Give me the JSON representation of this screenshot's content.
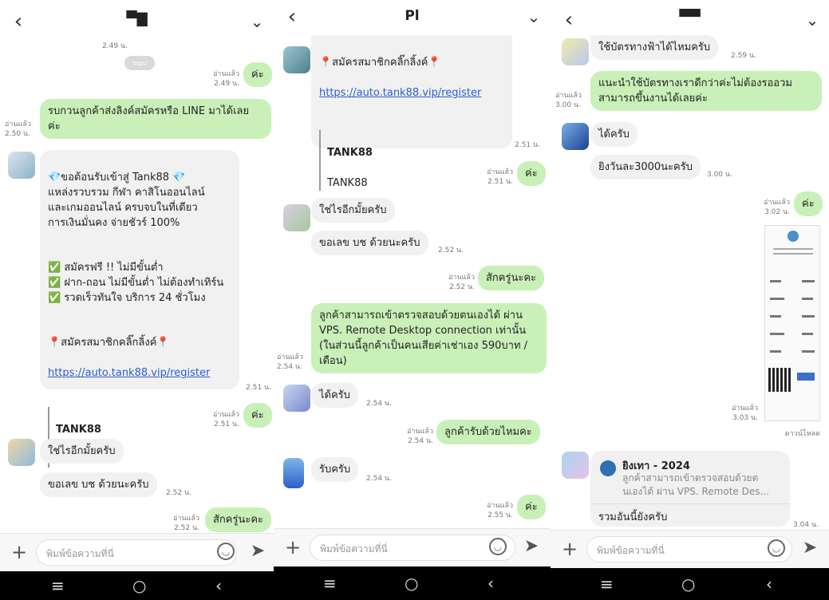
{
  "panels": [
    {
      "title": "▀▇",
      "input_placeholder": "พิมพ์ข้อความที่นี่",
      "top_time": "2.49 น.",
      "pill_text": "ขนบ",
      "messages": [
        {
          "dir": "out",
          "text": "ค่ะ",
          "read": "อ่านแล้ว",
          "time": "2.49 น."
        },
        {
          "dir": "out",
          "text": "รบกวนลูกค้าส่งลิงค์สมัครหรือ LINE มาได้เลย\nค่ะ",
          "read": "อ่านแล้ว",
          "time": "2.50 น."
        },
        {
          "dir": "in",
          "welcome": "💎ขอต้อนรับเข้าสู่ Tank88 💎\nแหล่งรวบรวม กีฬา คาสิโนออนไลน์\nและเกมออนไลน์ ครบจบในที่เดียว\nการเงินมั่นคง จ่ายชัวร์ 100%",
          "features": "✅ สมัครฟรี !! ไม่มีขั้นต่ำ\n✅ ฝาก-ถอน ไม่มีขั้นต่ำ ไม่ต้องทำเทิร์น\n✅ รวดเร็วทันใจ บริการ 24 ชั่วโมง",
          "register_label": "📍สมัครสมาชิกคลิ๊กลิ้งค์📍",
          "link": "https://auto.tank88.vip/register",
          "card_title": "TANK88",
          "card_sub": "TANK88",
          "time": "2.51 น."
        },
        {
          "dir": "out",
          "text": "ค่ะ",
          "read": "อ่านแล้ว",
          "time": "2.51 น."
        },
        {
          "dir": "in",
          "text": "ใช่ไรอีกมั้ยครับ"
        },
        {
          "dir": "in",
          "text": "ขอเลข บช ด้วยนะครับ",
          "time": "2.52 น."
        },
        {
          "dir": "out",
          "text": "สักครู่นะคะ",
          "read": "อ่านแล้ว",
          "time": "2.52 น."
        }
      ]
    },
    {
      "title": "Pl",
      "input_placeholder": "พิมพ์ข้อความที่นี่",
      "messages": [
        {
          "dir": "in",
          "register_label": "📍สมัครสมาชิกคลิ๊กลิ้งค์📍",
          "link": "https://auto.tank88.vip/register",
          "card_title": "TANK88",
          "card_sub": "TANK88",
          "time": "2.51 น."
        },
        {
          "dir": "out",
          "text": "ค่ะ",
          "read": "อ่านแล้ว",
          "time": "2.51 น."
        },
        {
          "dir": "in",
          "text": "ใช่ไรอีกมั้ยครับ"
        },
        {
          "dir": "in",
          "text": "ขอเลข บช ด้วยนะครับ",
          "time": "2.52 น."
        },
        {
          "dir": "out",
          "text": "สักครู่นะคะ",
          "read": "อ่านแล้ว",
          "time": "2.52 น."
        },
        {
          "dir": "out",
          "text": "ลูกค้าสามารถเข้าตรวจสอบด้วยตนเองได้ ผ่าน\nVPS. Remote Desktop connection เท่านั้น\n(ในส่วนนี้ลูกค้าเป็นคนเสียค่าเช่าเอง 590บาท /\nเดือน)",
          "read": "อ่านแล้ว",
          "time": "2.54 น."
        },
        {
          "dir": "in",
          "text": "ได้ครับ",
          "time": "2.54 น."
        },
        {
          "dir": "out",
          "text": "ลูกค้ารับด้วยไหมคะ",
          "read": "อ่านแล้ว",
          "time": "2.54 น."
        },
        {
          "dir": "in",
          "text": "รับครับ",
          "time": "2.54 น."
        },
        {
          "dir": "out",
          "text": "ค่ะ",
          "read": "อ่านแล้ว",
          "time": "2.55 น."
        }
      ]
    },
    {
      "title": "▀▀",
      "input_placeholder": "พิมพ์ข้อความที่นี่",
      "messages": [
        {
          "dir": "in",
          "text": "ใช้บัตรทางฟ้าได้ไหมครับ",
          "time": "2.59 น."
        },
        {
          "dir": "out",
          "text": "แนะนำใช้บัตรทางเราดีกว่าค่ะไม่ต้องรออวม\nสามารถขึ้นงานได้เลยค่ะ",
          "read": "อ่านแล้ว",
          "time": "3.00 น."
        },
        {
          "dir": "in",
          "text": "ได้ครับ"
        },
        {
          "dir": "in",
          "text": "ยิงวันละ3000นะครับ",
          "time": "3.00 น."
        },
        {
          "dir": "out",
          "text": "ค่ะ",
          "read": "อ่านแล้ว",
          "time": "3.02 น."
        },
        {
          "dir": "out",
          "image": "receipt",
          "read": "อ่านแล้ว",
          "time": "3.03 น.",
          "download": "ดาวน์โหลด"
        },
        {
          "dir": "in",
          "share_title": "ยิงเทา - 2024",
          "share_text": "ลูกค้าสามารถเข้าตรวจสอบด้วยต\nนเองได้ ผ่าน VPS. Remote Des...",
          "text": "รวมอันนี้ยังครับ",
          "time": "3.04 น."
        }
      ]
    }
  ]
}
